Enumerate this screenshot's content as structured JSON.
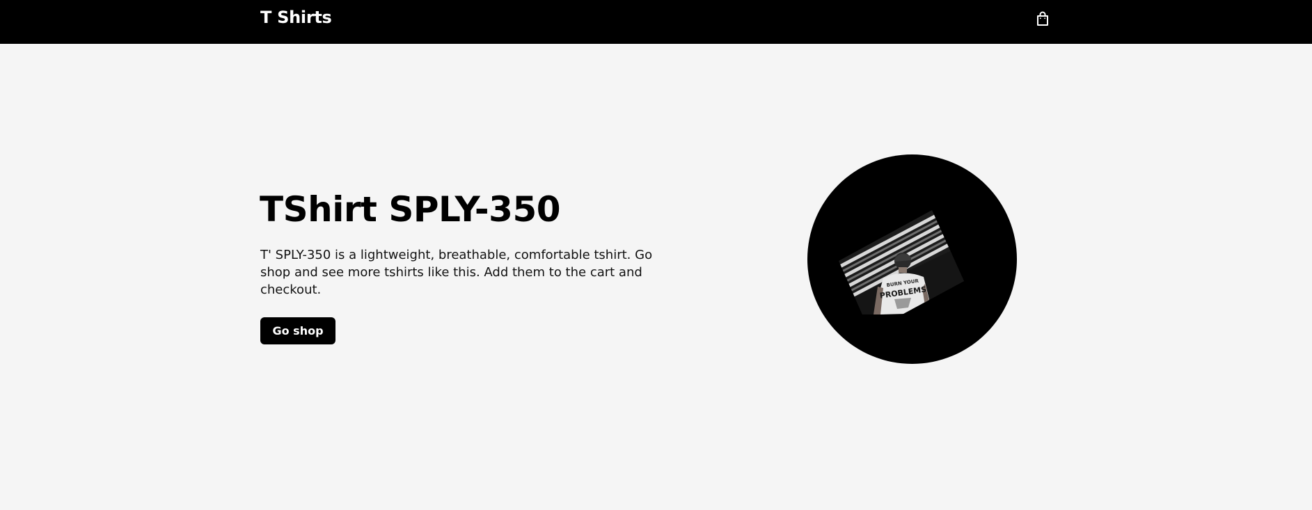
{
  "header": {
    "brand": "T Shirts",
    "cart_icon": "shopping-bag-icon"
  },
  "hero": {
    "title": "TShirt SPLY-350",
    "description": "T' SPLY-350 is a lightweight, breathable, comfortable tshirt. Go shop and see more tshirts like this. Add them to the cart and checkout.",
    "button_label": "Go shop"
  },
  "product_image": {
    "shirt_print_text": "BURN YOUR PROBLEMS"
  },
  "colors": {
    "header_bg": "#000000",
    "page_bg": "#f5f5f5",
    "button_bg": "#000000",
    "button_text": "#ffffff",
    "text": "#000000"
  }
}
